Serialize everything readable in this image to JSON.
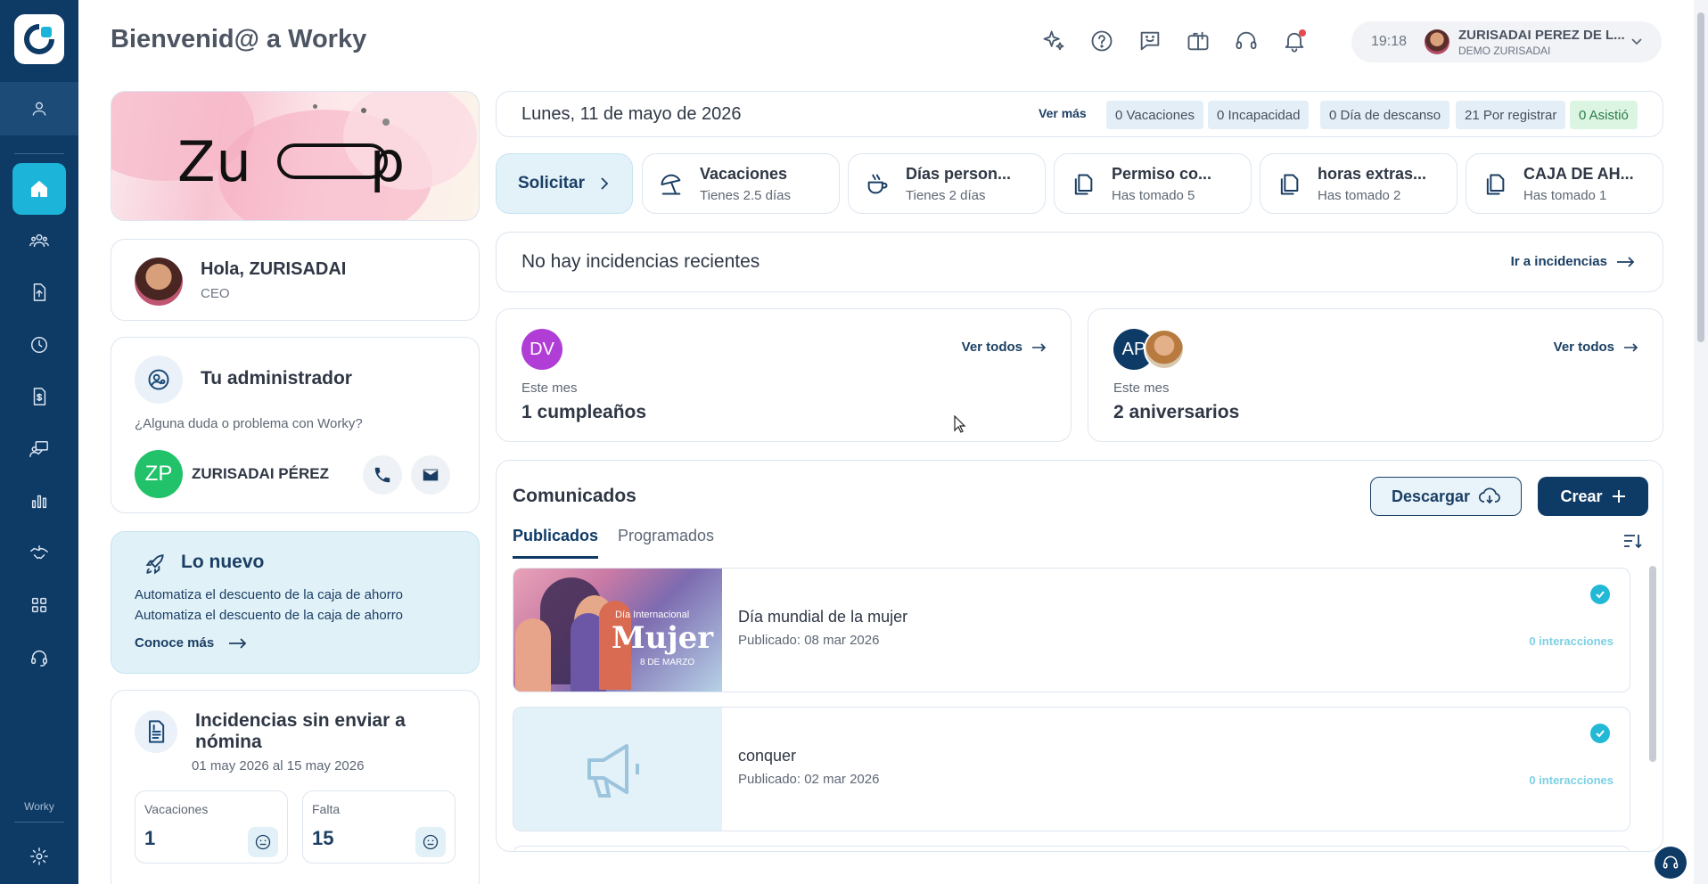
{
  "app": {
    "title": "Bienvenid@ a Worky",
    "footer_label": "Worky"
  },
  "sidebar": {
    "items": [
      {
        "name": "home",
        "icon": "home-icon",
        "active": true
      },
      {
        "name": "people",
        "icon": "people-icon"
      },
      {
        "name": "documents",
        "icon": "document-upload-icon"
      },
      {
        "name": "time",
        "icon": "clock-icon"
      },
      {
        "name": "payroll",
        "icon": "money-document-icon"
      },
      {
        "name": "training",
        "icon": "presentation-icon"
      },
      {
        "name": "reports",
        "icon": "bar-chart-icon"
      },
      {
        "name": "benefits",
        "icon": "handshake-icon"
      },
      {
        "name": "apps",
        "icon": "grid-icon"
      },
      {
        "name": "support",
        "icon": "headset-icon"
      }
    ],
    "settings_icon": "gear-icon"
  },
  "header": {
    "icons": [
      "sparkle-icon",
      "help-icon",
      "feedback-icon",
      "gift-icon",
      "headset-icon",
      "bell-icon"
    ],
    "time": "19:18",
    "user_name": "ZURISADAI PEREZ DE L...",
    "company": "DEMO ZURISADAI"
  },
  "banner": {
    "text": "Zu",
    "text_end": "p"
  },
  "greeting": {
    "hello": "Hola, ZURISADAI",
    "role": "CEO"
  },
  "admin": {
    "title": "Tu administrador",
    "question": "¿Alguna duda o problema con Worky?",
    "initials": "ZP",
    "name": "ZURISADAI PÉREZ"
  },
  "lo_nuevo": {
    "title": "Lo nuevo",
    "lines": [
      "Automatiza el descuento de la caja de ahorro",
      "Automatiza el descuento de la caja de ahorro"
    ],
    "link": "Conoce más"
  },
  "incidencias_nomina": {
    "title": "Incidencias sin enviar a nómina",
    "range": "01 may 2026 al 15 may 2026",
    "items": [
      {
        "label": "Vacaciones",
        "value": "1"
      },
      {
        "label": "Falta",
        "value": "15"
      }
    ]
  },
  "today": {
    "date": "Lunes, 11 de mayo de 2026",
    "ver_mas": "Ver más",
    "stats": [
      {
        "label": "0 Vacaciones"
      },
      {
        "label": "0 Incapacidad"
      },
      {
        "label": "0 Día de descanso"
      },
      {
        "label": "21 Por registrar"
      },
      {
        "label": "0 Asistió",
        "color": "green"
      }
    ]
  },
  "solicitar": {
    "label": "Solicitar",
    "requests": [
      {
        "title": "Vacaciones",
        "sub": "Tienes 2.5 días",
        "icon": "umbrella-icon"
      },
      {
        "title": "Días person...",
        "sub": "Tienes 2 días",
        "icon": "coffee-icon"
      },
      {
        "title": "Permiso co...",
        "sub": "Has tomado 5",
        "icon": "copy-icon"
      },
      {
        "title": "horas extras...",
        "sub": "Has tomado 2",
        "icon": "copy-icon"
      },
      {
        "title": "CAJA DE AH...",
        "sub": "Has tomado 1",
        "icon": "copy-icon"
      }
    ]
  },
  "incidencias": {
    "empty": "No hay incidencias recientes",
    "link": "Ir a incidencias"
  },
  "cumpleanos": {
    "initials": "DV",
    "link": "Ver todos",
    "sub": "Este mes",
    "value": "1 cumpleaños"
  },
  "aniversarios": {
    "initials": "AP",
    "link": "Ver todos",
    "sub": "Este mes",
    "value": "2 aniversarios"
  },
  "comunicados": {
    "title": "Comunicados",
    "download": "Descargar",
    "create": "Crear",
    "tabs": [
      "Publicados",
      "Programados"
    ],
    "posts": [
      {
        "title": "Día mundial de la mujer",
        "date": "Publicado: 08 mar 2026",
        "interactions": "0 interacciones",
        "img_caption_1": "Día Internacional",
        "img_caption_2": "Mujer",
        "img_caption_3": "8 DE MARZO"
      },
      {
        "title": "conquer",
        "date": "Publicado: 02 mar 2026",
        "interactions": "0 interacciones"
      }
    ]
  },
  "colors": {
    "navy": "#0e3a66",
    "accent": "#1cb5d9",
    "green": "#22c26a",
    "purple": "#b03ed6"
  }
}
